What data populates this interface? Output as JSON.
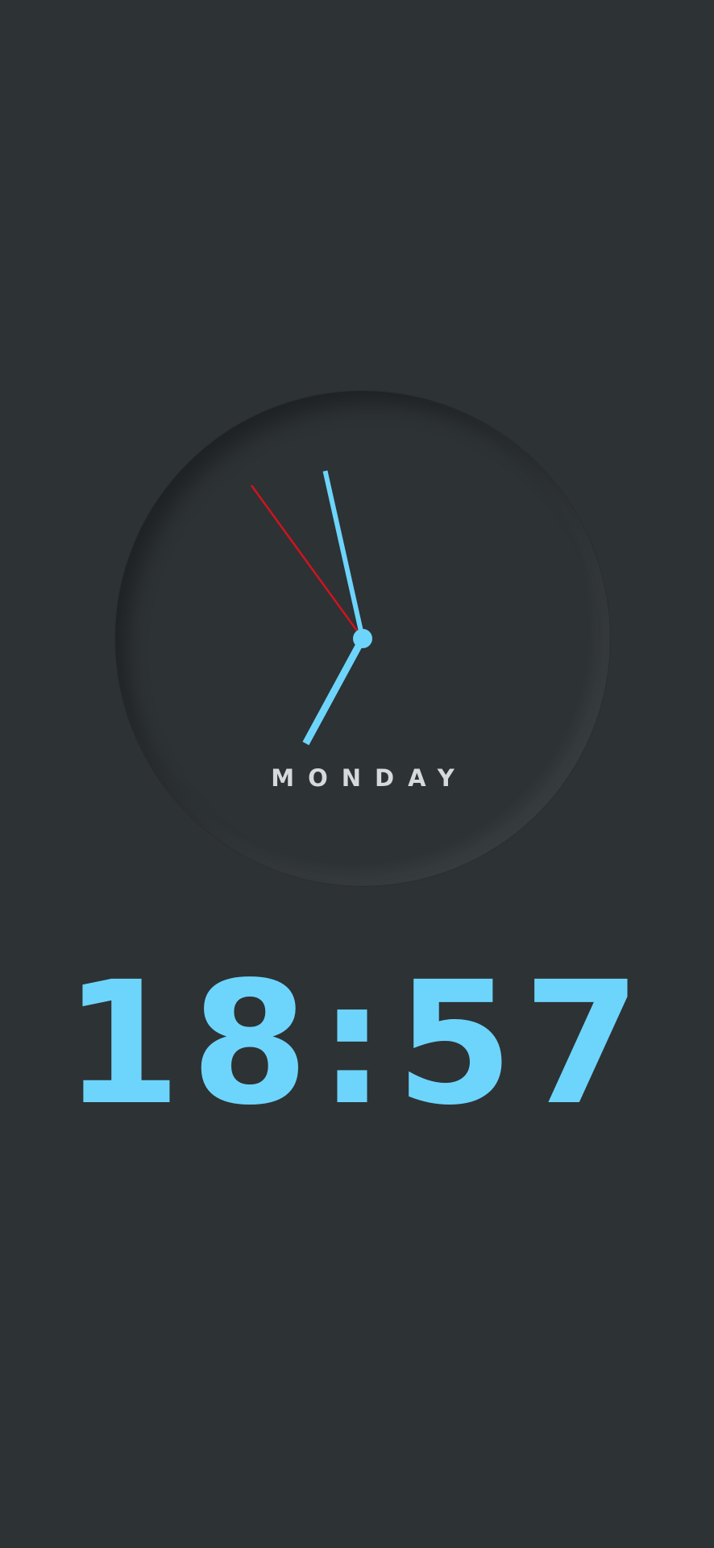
{
  "clock": {
    "day": "MONDAY",
    "time": "18:57",
    "hour": 6,
    "minute": 57,
    "second": 54,
    "colors": {
      "background": "#2d3235",
      "hand": "#6dd5fb",
      "second_hand": "#d0141e",
      "day_text": "#d6d9db"
    }
  }
}
